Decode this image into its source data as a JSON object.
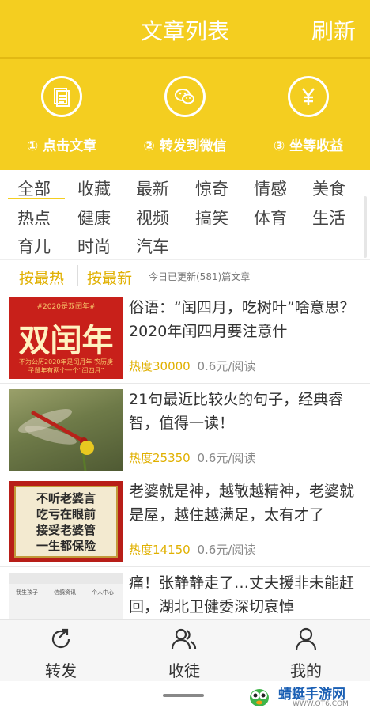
{
  "topbar": {
    "title": "文章列表",
    "refresh_label": "刷新"
  },
  "steps": [
    {
      "label": "① 点击文章",
      "icon": "document-icon"
    },
    {
      "label": "② 转发到微信",
      "icon": "wechat-icon"
    },
    {
      "label": "③ 坐等收益",
      "icon": "yen-icon"
    }
  ],
  "categories": [
    "全部",
    "收藏",
    "最新",
    "惊奇",
    "情感",
    "美食",
    "热点",
    "健康",
    "视频",
    "搞笑",
    "体育",
    "生活",
    "育儿",
    "时尚",
    "汽车"
  ],
  "active_category": "全部",
  "sort": {
    "hot_label": "按最热",
    "new_label": "按最新",
    "info": "今日已更新(581)篇文章"
  },
  "articles": [
    {
      "title": "俗语：“闰四月，吃树叶”啥意思？2020年闰四月要注意什",
      "heat": "热度30000",
      "price": "0.6元/阅读",
      "thumb": {
        "top_text": "#2020是双闰年#",
        "main_text": "双闰年",
        "sub_text": "不为公历2020年是闰月年 农历庚子鼠年有两个一个“闰四月”"
      }
    },
    {
      "title": "21句最近比较火的句子，经典睿智，值得一读！",
      "heat": "热度25350",
      "price": "0.6元/阅读"
    },
    {
      "title": "老婆就是神，越敬越精神，老婆就是屋，越住越满足，太有才了",
      "heat": "热度14150",
      "price": "0.6元/阅读",
      "thumb": {
        "lines": [
          "不听老婆言",
          "吃亏在眼前",
          "接受老婆管",
          "一生都保险"
        ]
      }
    },
    {
      "title": "痛！张静静走了…丈夫援非未能赶回，湖北卫健委深切哀悼",
      "heat": "",
      "price": "",
      "thumb": {
        "labels": [
          "我生孩子",
          "信鸽资讯",
          "个人中心"
        ]
      }
    }
  ],
  "tabs": [
    {
      "label": "转发",
      "icon": "share-icon"
    },
    {
      "label": "收徒",
      "icon": "users-icon"
    },
    {
      "label": "我的",
      "icon": "user-icon"
    }
  ],
  "watermark": {
    "name": "蜻蜓手游网",
    "url": "WWW.QT6.COM"
  },
  "colors": {
    "brand": "#f4ce20",
    "accent": "#e0b000"
  }
}
